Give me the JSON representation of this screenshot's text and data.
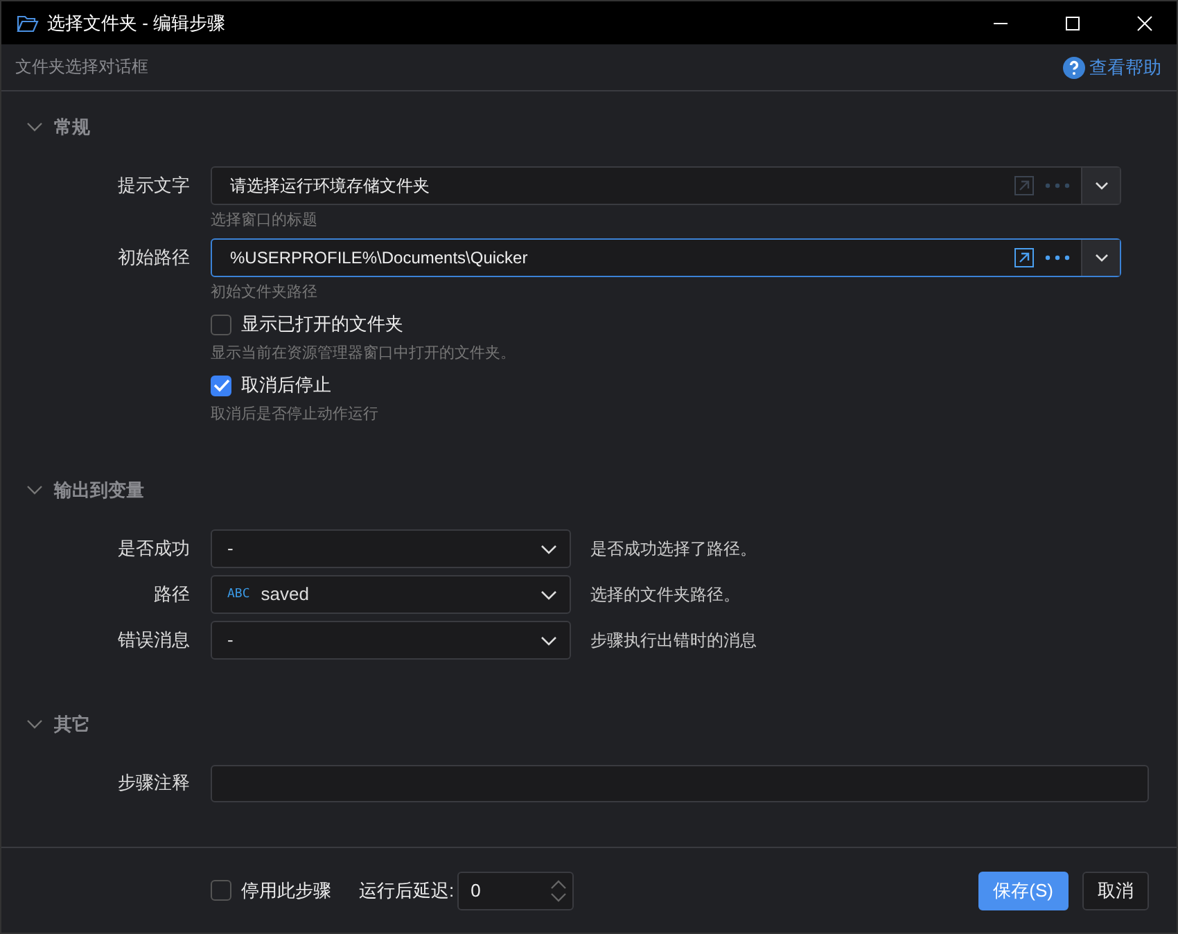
{
  "window": {
    "title": "选择文件夹 - 编辑步骤"
  },
  "header": {
    "subtitle": "文件夹选择对话框",
    "help_link": "查看帮助"
  },
  "sections": [
    {
      "title": "常规",
      "expanded": true,
      "items": [
        {
          "kind": "text_input",
          "label": "提示文字",
          "value": "请选择运行环境存储文件夹",
          "hint": "选择窗口的标题",
          "focused": false
        },
        {
          "kind": "text_input",
          "label": "初始路径",
          "value": "%USERPROFILE%\\Documents\\Quicker",
          "hint": "初始文件夹路径",
          "focused": true
        },
        {
          "kind": "checkbox",
          "label": "显示已打开的文件夹",
          "hint": "显示当前在资源管理器窗口中打开的文件夹。",
          "checked": false
        },
        {
          "kind": "checkbox",
          "label": "取消后停止",
          "hint": "取消后是否停止动作运行",
          "checked": true
        }
      ]
    },
    {
      "title": "输出到变量",
      "expanded": true,
      "items": [
        {
          "kind": "variable_select",
          "label": "是否成功",
          "value": "-",
          "description": "是否成功选择了路径。"
        },
        {
          "kind": "variable_select",
          "label": "路径",
          "type_tag": "ABC",
          "value": "saved",
          "description": "选择的文件夹路径。"
        },
        {
          "kind": "variable_select",
          "label": "错误消息",
          "value": "-",
          "description": "步骤执行出错时的消息"
        }
      ]
    },
    {
      "title": "其它",
      "expanded": true,
      "items": [
        {
          "kind": "text_area",
          "label": "步骤注释"
        }
      ]
    }
  ],
  "footer": {
    "disable_step": {
      "label": "停用此步骤",
      "checked": false
    },
    "delay": {
      "label": "运行后延迟:",
      "value": "0"
    },
    "buttons": [
      {
        "label": "保存(S)",
        "primary": true
      },
      {
        "label": "取消",
        "primary": false
      }
    ]
  }
}
